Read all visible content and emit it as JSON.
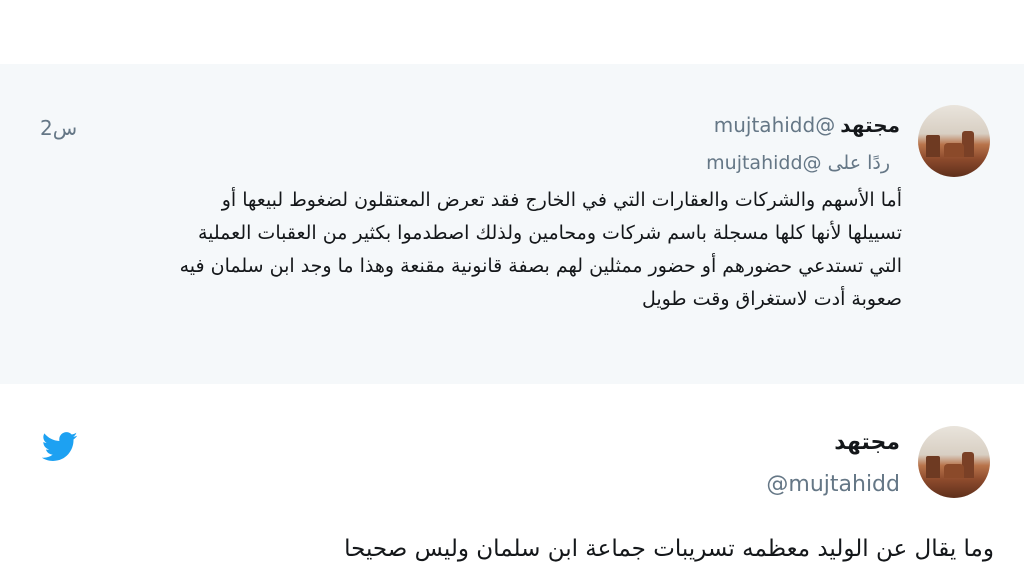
{
  "reply_tweet": {
    "display_name": "مجتهد",
    "handle": "@mujtahidd",
    "time": "2س",
    "replying_prefix": "ردًا على",
    "replying_to": "@mujtahidd",
    "body_lines": [
      "أما الأسهم والشركات والعقارات التي في الخارج فقد تعرض المعتقلون لضغوط لبيعها أو",
      "تسييلها لأنها كلها مسجلة باسم شركات ومحامين ولذلك اصطدموا بكثير من العقبات العملية",
      "التي تستدعي حضورهم أو حضور ممثلين لهم بصفة قانونية مقنعة وهذا ما وجد ابن سلمان فيه",
      "صعوبة أدت لاستغراق وقت طويل"
    ]
  },
  "main_tweet": {
    "display_name": "مجتهد",
    "handle": "@mujtahidd",
    "body": "وما يقال عن الوليد معظمه تسريبات جماعة ابن سلمان وليس صحيحا"
  },
  "icons": {
    "brand": "twitter-bird-icon",
    "brand_color": "#1da1f2"
  }
}
